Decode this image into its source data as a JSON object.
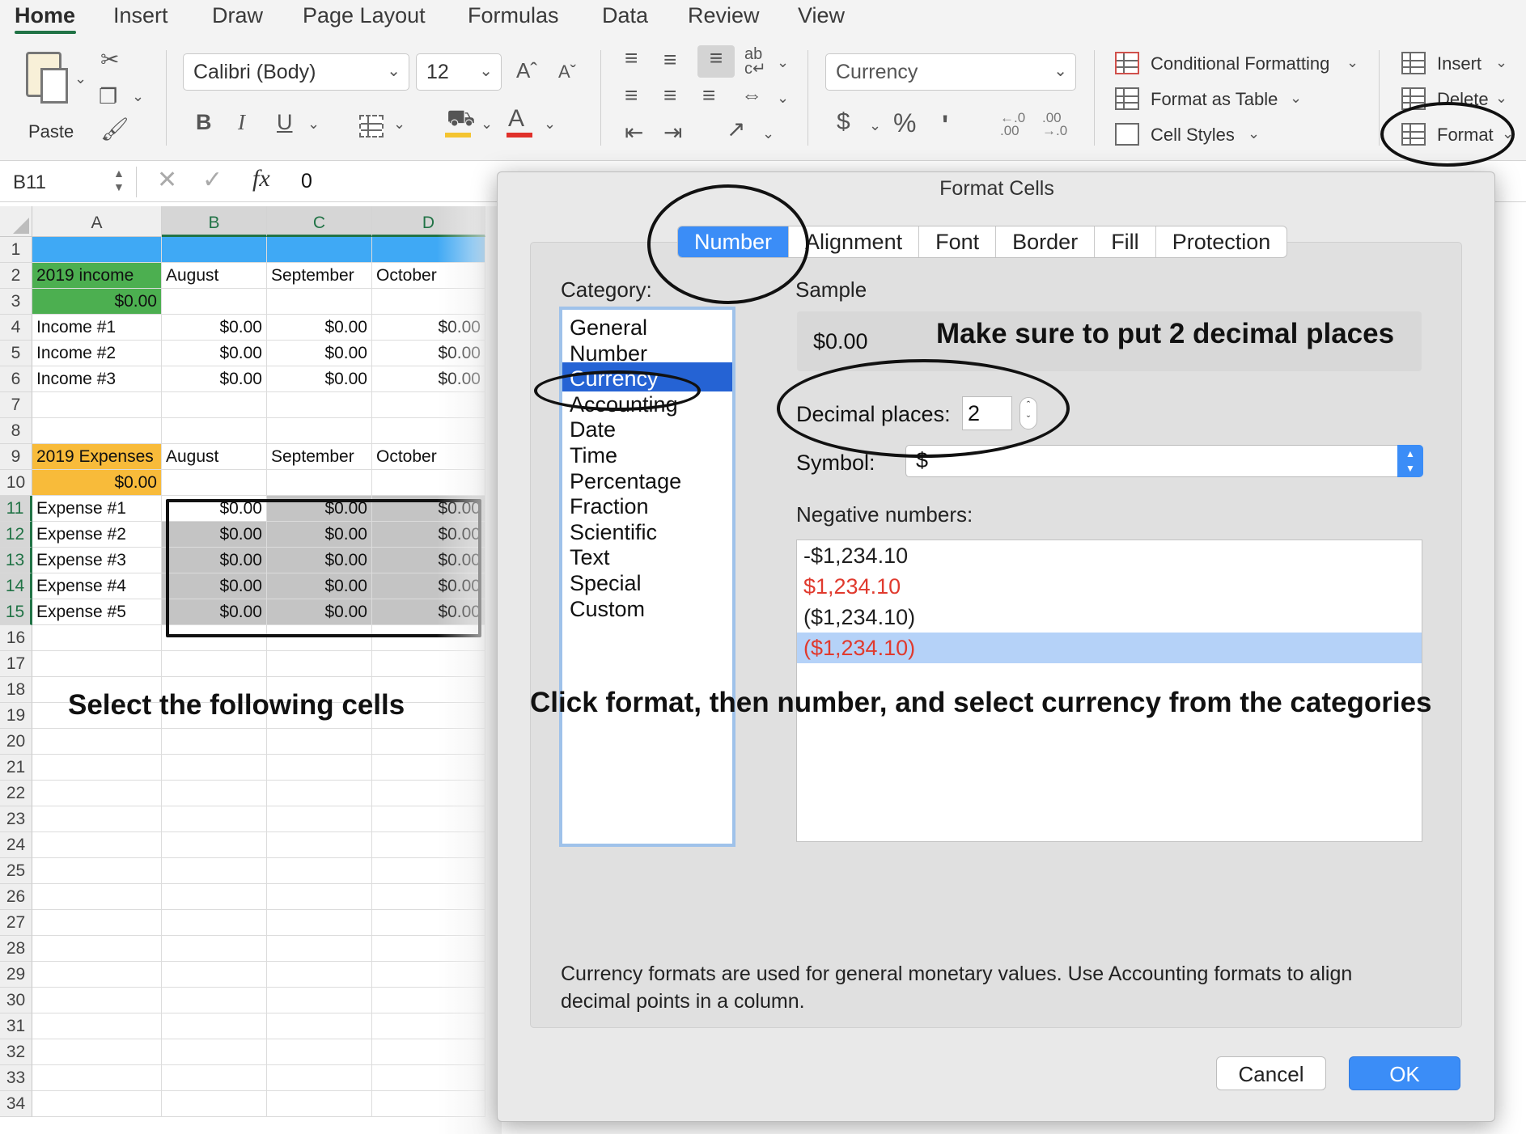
{
  "ribbon_tabs": [
    "Home",
    "Insert",
    "Draw",
    "Page Layout",
    "Formulas",
    "Data",
    "Review",
    "View"
  ],
  "ribbon": {
    "paste_label": "Paste",
    "font_name": "Calibri (Body)",
    "font_size": "12",
    "bold": "B",
    "italic": "I",
    "underline": "U",
    "number_format": "Currency",
    "dollar": "$",
    "percent": "%",
    "comma": "'",
    "conditional_formatting": "Conditional Formatting",
    "format_as_table": "Format as Table",
    "cell_styles": "Cell Styles",
    "insert": "Insert",
    "delete": "Delete",
    "format": "Format"
  },
  "formula_bar": {
    "name_box": "B11",
    "fx": "fx",
    "value": "0"
  },
  "sheet": {
    "columns": [
      "A",
      "B",
      "C",
      "D"
    ],
    "rows": [
      "1",
      "2",
      "3",
      "4",
      "5",
      "6",
      "7",
      "8",
      "9",
      "10",
      "11",
      "12",
      "13",
      "14",
      "15",
      "16",
      "17",
      "18",
      "19",
      "20",
      "21",
      "22",
      "23",
      "24",
      "25",
      "26",
      "27",
      "28",
      "29",
      "30",
      "31",
      "32",
      "33",
      "34"
    ],
    "income_title": "2019 income",
    "income_total": "$0.00",
    "expense_title": "2019 Expenses",
    "expense_total": "$0.00",
    "months": [
      "August",
      "September",
      "October"
    ],
    "income_rows": [
      {
        "label": "Income #1",
        "values": [
          "$0.00",
          "$0.00",
          "$0.00"
        ]
      },
      {
        "label": "Income #2",
        "values": [
          "$0.00",
          "$0.00",
          "$0.00"
        ]
      },
      {
        "label": "Income #3",
        "values": [
          "$0.00",
          "$0.00",
          "$0.00"
        ]
      }
    ],
    "expense_rows": [
      {
        "label": "Expense #1",
        "values": [
          "$0.00",
          "$0.00",
          "$0.00"
        ]
      },
      {
        "label": "Expense #2",
        "values": [
          "$0.00",
          "$0.00",
          "$0.00"
        ]
      },
      {
        "label": "Expense #3",
        "values": [
          "$0.00",
          "$0.00",
          "$0.00"
        ]
      },
      {
        "label": "Expense #4",
        "values": [
          "$0.00",
          "$0.00",
          "$0.00"
        ]
      },
      {
        "label": "Expense #5",
        "values": [
          "$0.00",
          "$0.00",
          "$0.00"
        ]
      }
    ],
    "instruction": "Select the following cells"
  },
  "dialog": {
    "title": "Format Cells",
    "tabs": [
      "Number",
      "Alignment",
      "Font",
      "Border",
      "Fill",
      "Protection"
    ],
    "category_label": "Category:",
    "categories": [
      "General",
      "Number",
      "Currency",
      "Accounting",
      "Date",
      "Time",
      "Percentage",
      "Fraction",
      "Scientific",
      "Text",
      "Special",
      "Custom"
    ],
    "selected_category": "Currency",
    "sample_label": "Sample",
    "sample_value": "$0.00",
    "sample_note": "Make sure to put 2 decimal places",
    "decimal_label": "Decimal places:",
    "decimal_value": "2",
    "symbol_label": "Symbol:",
    "symbol_value": "$",
    "negative_label": "Negative numbers:",
    "negative_options": [
      "-$1,234.10",
      "$1,234.10",
      "($1,234.10)",
      "($1,234.10)"
    ],
    "description": "Currency formats are used for general monetary values.  Use Accounting formats to align decimal points in a column.",
    "cancel": "Cancel",
    "ok": "OK",
    "instruction": "Click format, then number, and select currency from the categories"
  },
  "colors": {
    "excel_green": "#217346",
    "header_blue": "#3fa9f5",
    "income_green": "#4caf50",
    "expense_orange": "#f8bb3a",
    "accent_blue": "#3b8df7",
    "negative_red": "#e03a2e"
  }
}
